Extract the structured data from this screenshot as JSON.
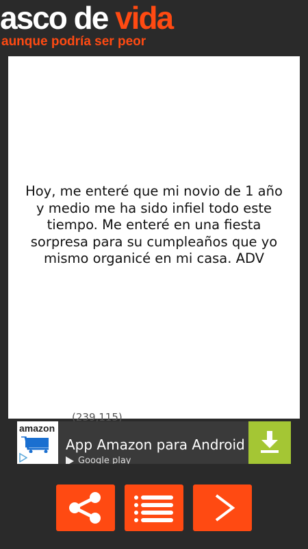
{
  "header": {
    "logo_part1": "asco de ",
    "logo_part2": "vida",
    "tagline": "aunque podría ser peor"
  },
  "story": {
    "text": "Hoy, me enteré que mi novio de 1 año y medio me ha sido infiel todo este tiempo. Me enteré en una fiesta sorpresa para su cumpleaños que yo mismo organicé en mi casa. ADV",
    "ratings_partial": "  (239,115)"
  },
  "ad": {
    "brand": "amazon",
    "title": "App Amazon para Android",
    "store": "Google play",
    "logo_icon": "amazon-cart-icon",
    "download_icon": "download-icon",
    "accent_color": "#a4c634"
  },
  "actions": {
    "share_icon": "share-icon",
    "list_icon": "list-icon",
    "next_icon": "chevron-right-icon"
  },
  "colors": {
    "brand": "#ff4a12",
    "background": "#2a2a2a"
  }
}
